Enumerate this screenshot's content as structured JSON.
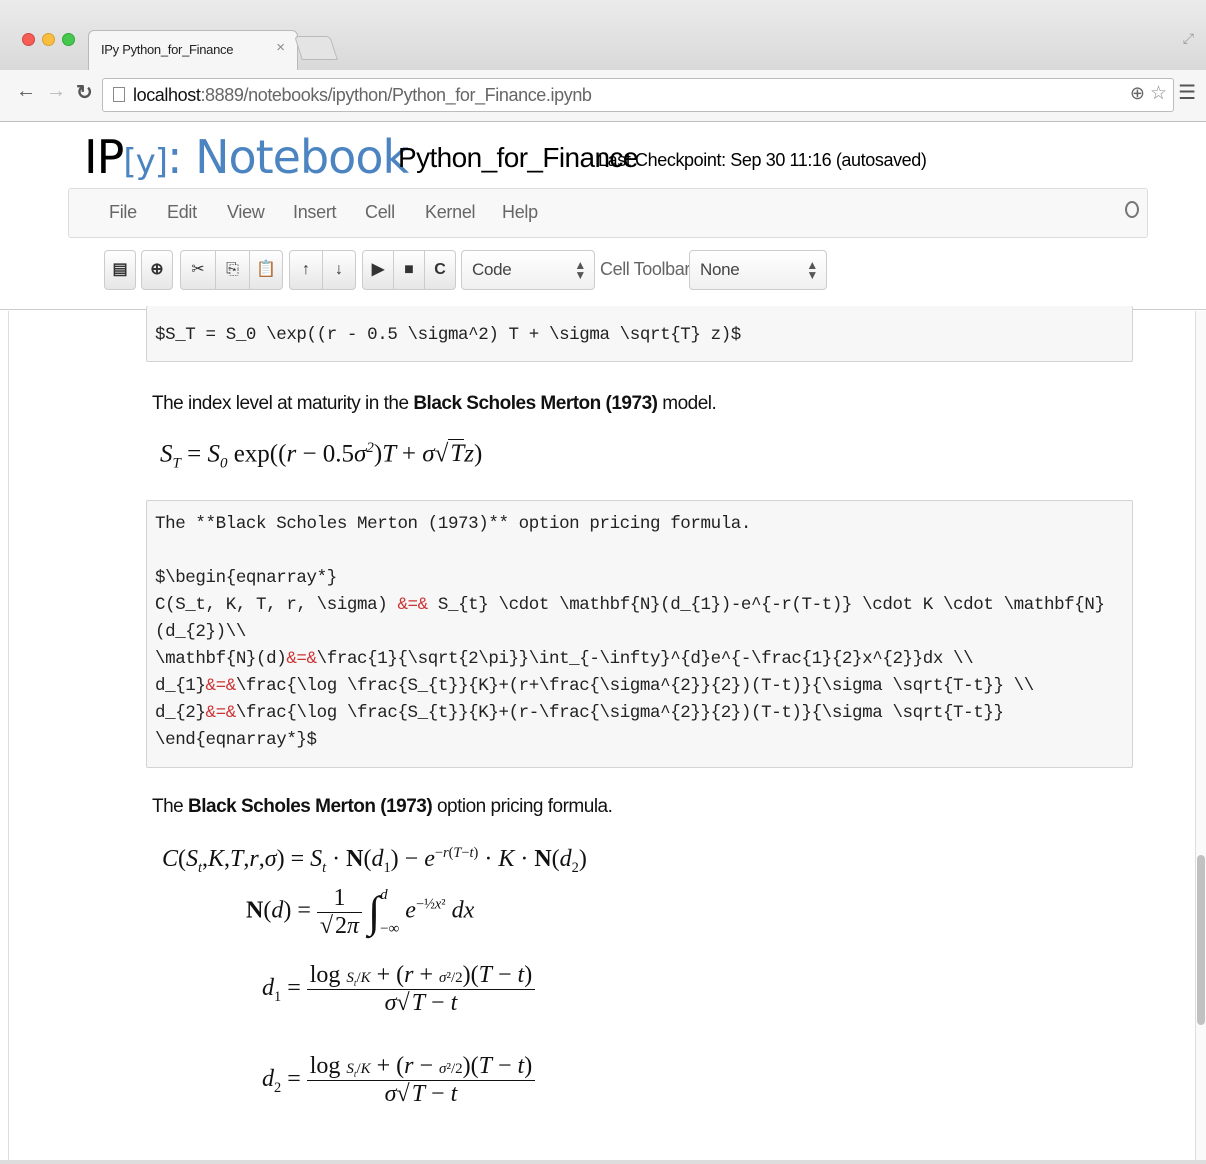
{
  "browser": {
    "tab_title": "IPy Python_for_Finance",
    "tab_close": "×",
    "url_host": "localhost",
    "url_path": ":8889/notebooks/ipython/Python_for_Finance.ipynb"
  },
  "notebook": {
    "logo_prefix": "IP",
    "logo_y": "[y]",
    "logo_suffix": ":",
    "logo_word": " Notebook",
    "title": "Python_for_Finance",
    "checkpoint": "Last Checkpoint: Sep 30 11:16 (autosaved)"
  },
  "menu": [
    "File",
    "Edit",
    "View",
    "Insert",
    "Cell",
    "Kernel",
    "Help"
  ],
  "toolbar": {
    "cell_type": "Code",
    "cell_toolbar_label": "Cell Toolbar:",
    "cell_toolbar_value": "None",
    "icons": [
      "save-icon",
      "add-cell-icon",
      "cut-icon",
      "copy-icon",
      "paste-icon",
      "move-up-icon",
      "move-down-icon",
      "run-icon",
      "stop-icon",
      "restart-icon"
    ]
  },
  "cells": {
    "code1": "$S_T = S_0 \\exp((r - 0.5 \\sigma^2) T + \\sigma \\sqrt{T} z)$",
    "md1_pre": "The index level at maturity in the ",
    "md1_bold": "Black Scholes Merton (1973)",
    "md1_post": " model.",
    "code2_lines": [
      "The **Black Scholes Merton (1973)** option pricing formula.",
      "",
      "$\\begin{eqnarray*}",
      "C(S_t, K, T, r, \\sigma) &=& S_{t} \\cdot \\mathbf{N}(d_{1})-e^{-r(T-t)} \\cdot K \\cdot \\mathbf{N}",
      "(d_{2})\\\\",
      "\\mathbf{N}(d)&=&\\frac{1}{\\sqrt{2\\pi}}\\int_{-\\infty}^{d}e^{-\\frac{1}{2}x^{2}}dx \\\\",
      "d_{1}&=&\\frac{\\log \\frac{S_{t}}{K}+(r+\\frac{\\sigma^{2}}{2})(T-t)}{\\sigma \\sqrt{T-t}} \\\\",
      "d_{2}&=&\\frac{\\log \\frac{S_{t}}{K}+(r-\\frac{\\sigma^{2}}{2})(T-t)}{\\sigma \\sqrt{T-t}}",
      "\\end{eqnarray*}$"
    ],
    "md2_pre": "The ",
    "md2_bold": "Black Scholes Merton (1973)",
    "md2_post": " option pricing formula."
  }
}
